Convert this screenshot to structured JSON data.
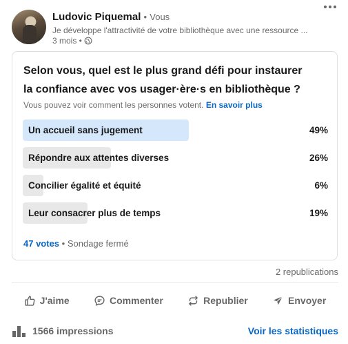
{
  "author": {
    "name": "Ludovic Piquemal",
    "separator": "•",
    "relation": "Vous",
    "headline": "Je développe l'attractivité de votre bibliothèque avec une ressource ...",
    "time": "3 mois •"
  },
  "poll": {
    "question": "Selon vous, quel est le plus grand défi pour instaurer la confiance avec vos usager·ère·s en bibliothèque ?",
    "visibility_note": "Vous pouvez voir comment les personnes votent.",
    "learn_more": "En savoir plus",
    "options": [
      {
        "label": "Un accueil sans jugement",
        "percent": "49%",
        "value": 49,
        "highlighted": true
      },
      {
        "label": "Répondre aux attentes diverses",
        "percent": "26%",
        "value": 26,
        "highlighted": false
      },
      {
        "label": "Concilier égalité et équité",
        "percent": "6%",
        "value": 6,
        "highlighted": false
      },
      {
        "label": "Leur consacrer plus de temps",
        "percent": "19%",
        "value": 19,
        "highlighted": false
      }
    ],
    "votes": "47 votes",
    "status": "Sondage fermé"
  },
  "reposts": "2 republications",
  "actions": {
    "like": "J'aime",
    "comment": "Commenter",
    "repost": "Republier",
    "send": "Envoyer"
  },
  "footer": {
    "impressions": "1566 impressions",
    "stats_link": "Voir les statistiques"
  },
  "colors": {
    "accent": "#0a66c2",
    "bar_highlight": "#d5e7fa",
    "bar_default": "#e8e8e8"
  },
  "icons": [
    "globe-icon",
    "more-icon",
    "like-icon",
    "comment-icon",
    "repost-icon",
    "send-icon",
    "analytics-icon"
  ]
}
